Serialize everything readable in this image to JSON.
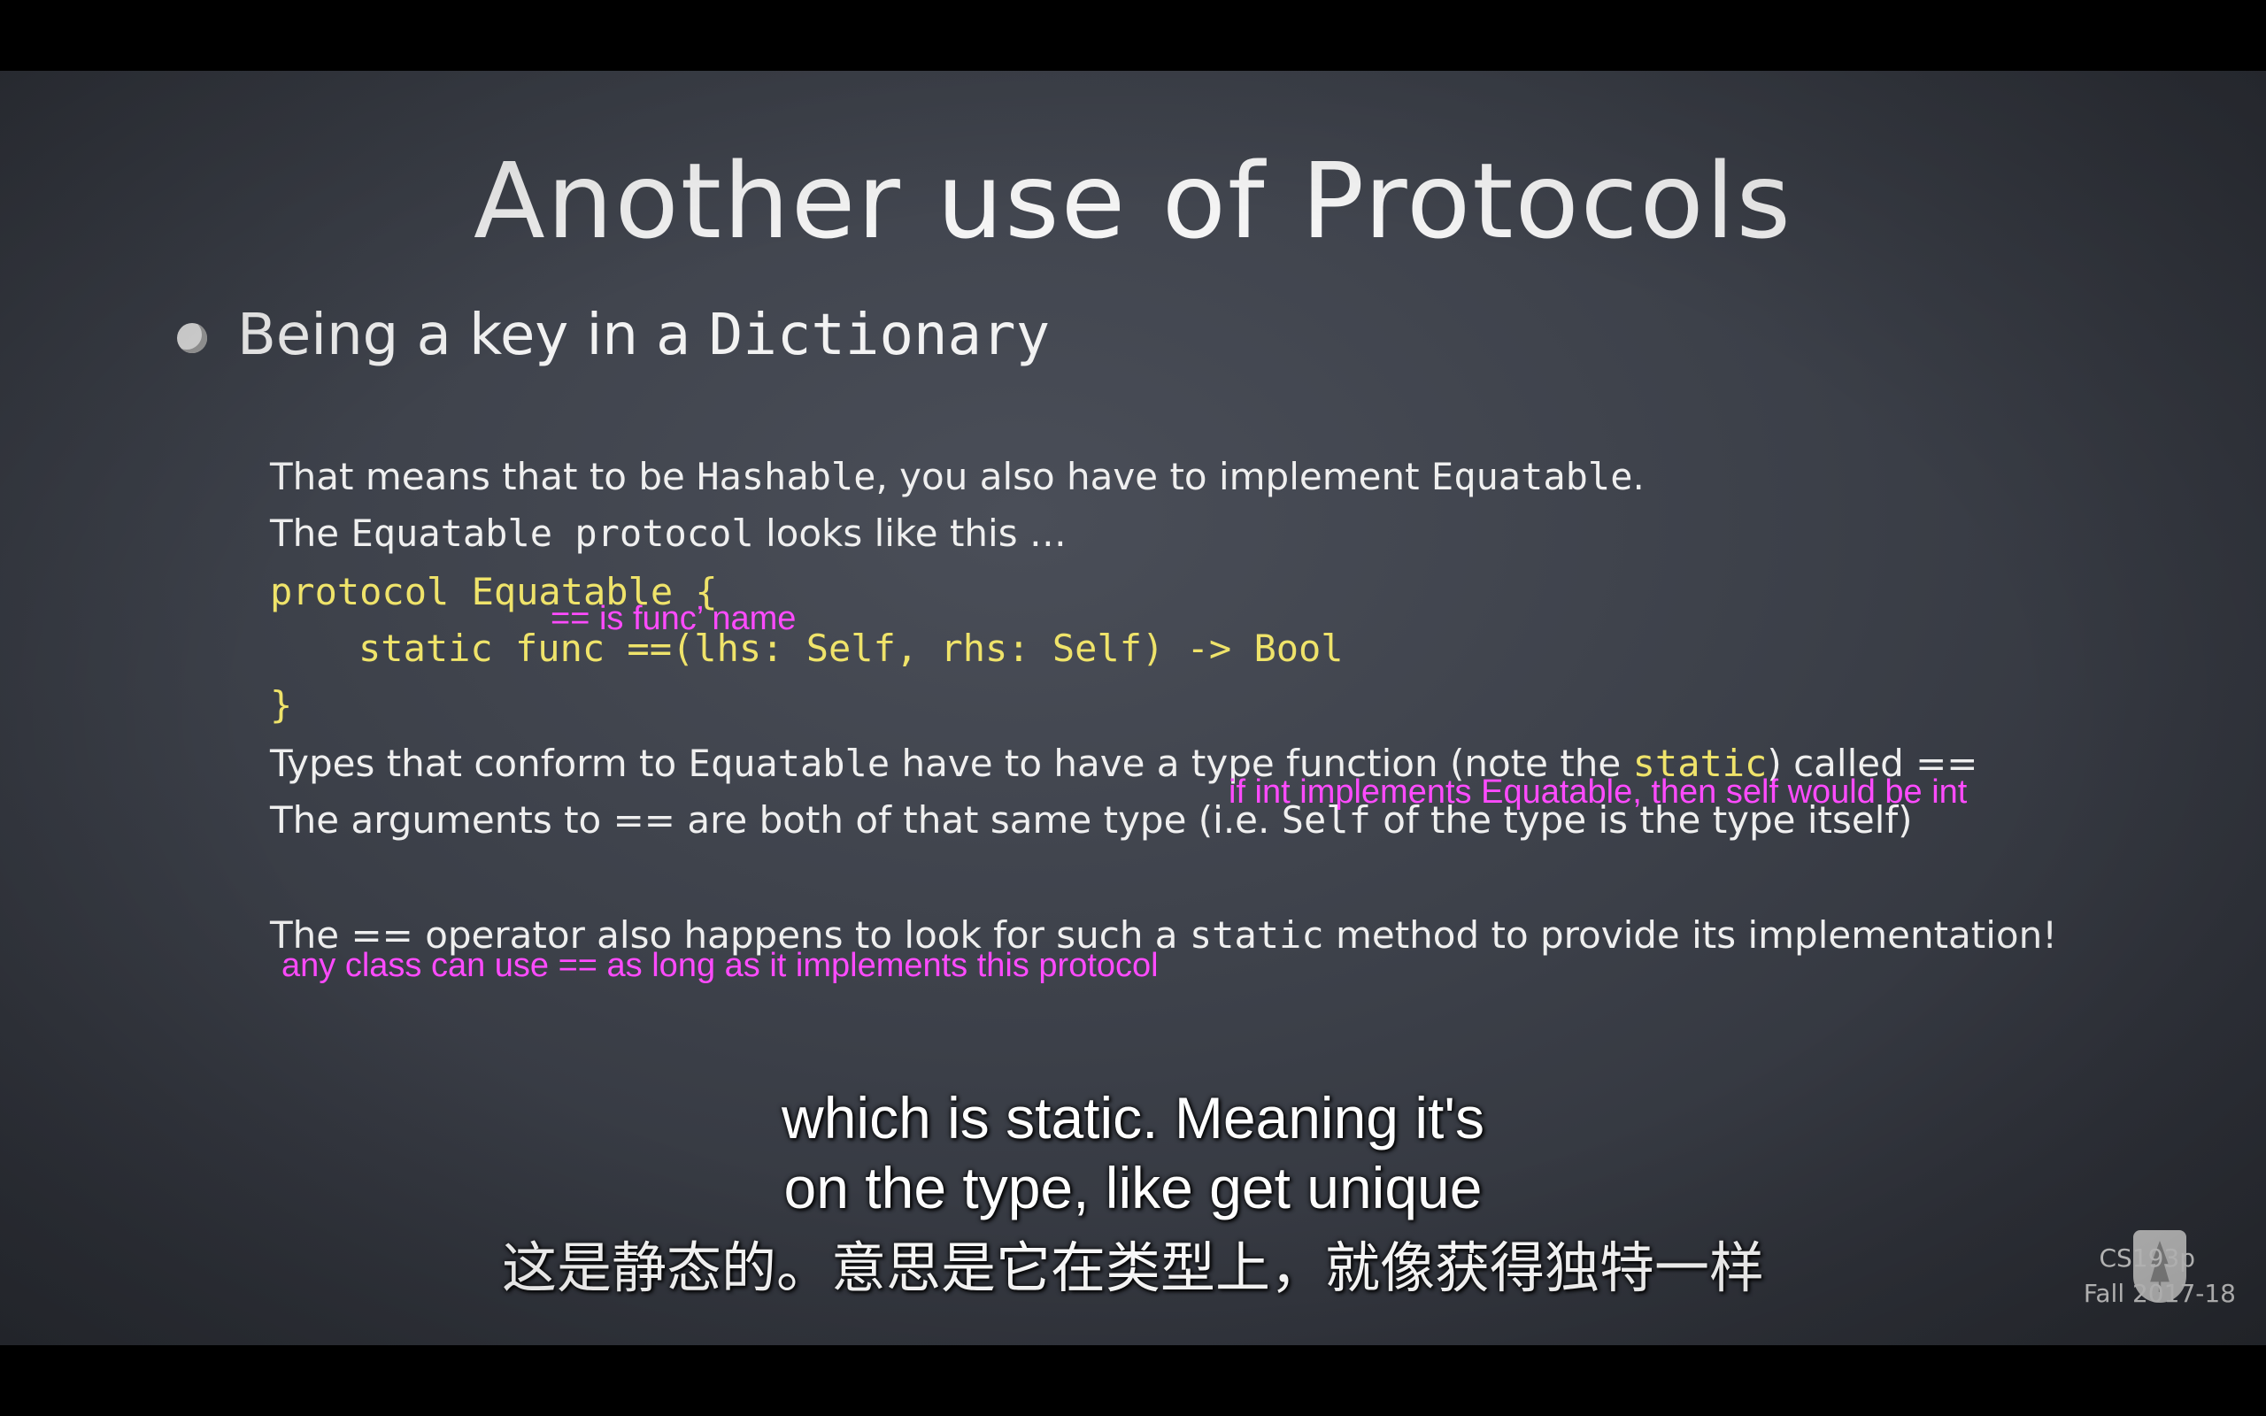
{
  "slide": {
    "title": "Another use of Protocols",
    "bullet": {
      "text": "Being a key in a ",
      "code": "Dictionary"
    },
    "line1": {
      "a": "That means that to be ",
      "b": "Hashable",
      "c": ", you also have to implement ",
      "d": "Equatable",
      "e": "."
    },
    "line2": {
      "a": "The ",
      "b": "Equatable protocol",
      "c": " looks like this …"
    },
    "code1": "protocol Equatable {",
    "code2": "static func ==(lhs: Self, rhs: Self) -> Bool",
    "code3": "}",
    "note1": "== is func’ name",
    "line3": {
      "a": "Types that conform to ",
      "b": "Equatable",
      "c": " have to have a type function (note the ",
      "d": "static",
      "e": ") called =="
    },
    "line4": {
      "a": "The arguments to == are both of that same type (i.e. ",
      "b": "Self",
      "c": " of the type is the type itself)"
    },
    "note2": "if int implements Equatable, then self would be int",
    "line5": {
      "a": "The == operator also happens to look for such a ",
      "b": "static",
      "c": " method to provide its implementation!"
    },
    "note3": "any class can use == as long as it implements this protocol",
    "course": {
      "name": "CS193p",
      "term": "Fall 2017-18"
    }
  },
  "subtitles": {
    "en_line1": "which is static. Meaning it's",
    "en_line2": "on the type, like get unique",
    "cn_line": "这是静态的。意思是它在类型上，就像获得独特一样"
  },
  "colors": {
    "annotation": "#ff4bff",
    "code": "#efe36a",
    "slide_bg": "#3c4049"
  }
}
